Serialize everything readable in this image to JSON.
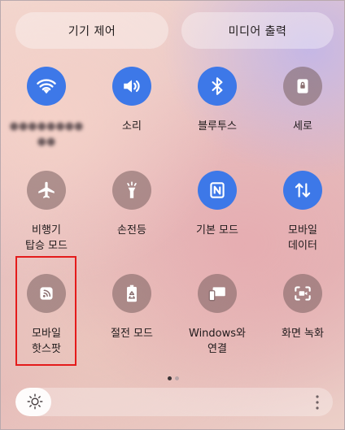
{
  "top_buttons": {
    "device_control": "기기 제어",
    "media_output": "미디어 출력"
  },
  "tiles": [
    {
      "label": "●●●●●●●● ●●",
      "icon": "wifi-icon",
      "state": "on"
    },
    {
      "label": "소리",
      "icon": "sound-icon",
      "state": "on"
    },
    {
      "label": "블루투스",
      "icon": "bluetooth-icon",
      "state": "on"
    },
    {
      "label": "세로",
      "icon": "rotation-lock-icon",
      "state": "off"
    },
    {
      "label": "비행기\n탑승 모드",
      "icon": "airplane-icon",
      "state": "off"
    },
    {
      "label": "손전등",
      "icon": "flashlight-icon",
      "state": "off"
    },
    {
      "label": "기본 모드",
      "icon": "nfc-icon",
      "state": "on"
    },
    {
      "label": "모바일\n데이터",
      "icon": "mobile-data-icon",
      "state": "on"
    },
    {
      "label": "모바일\n핫스팟",
      "icon": "hotspot-icon",
      "state": "off"
    },
    {
      "label": "절전 모드",
      "icon": "power-saving-icon",
      "state": "off"
    },
    {
      "label": "Windows와\n연결",
      "icon": "link-to-windows-icon",
      "state": "off"
    },
    {
      "label": "화면 녹화",
      "icon": "screen-recorder-icon",
      "state": "off"
    }
  ],
  "colors": {
    "active": "#3d78e8",
    "inactive": "#8a6e6f",
    "highlight": "#e41b1b"
  },
  "pagination": {
    "pages": 2,
    "current": 1
  },
  "brightness": {
    "level": 0.1
  }
}
